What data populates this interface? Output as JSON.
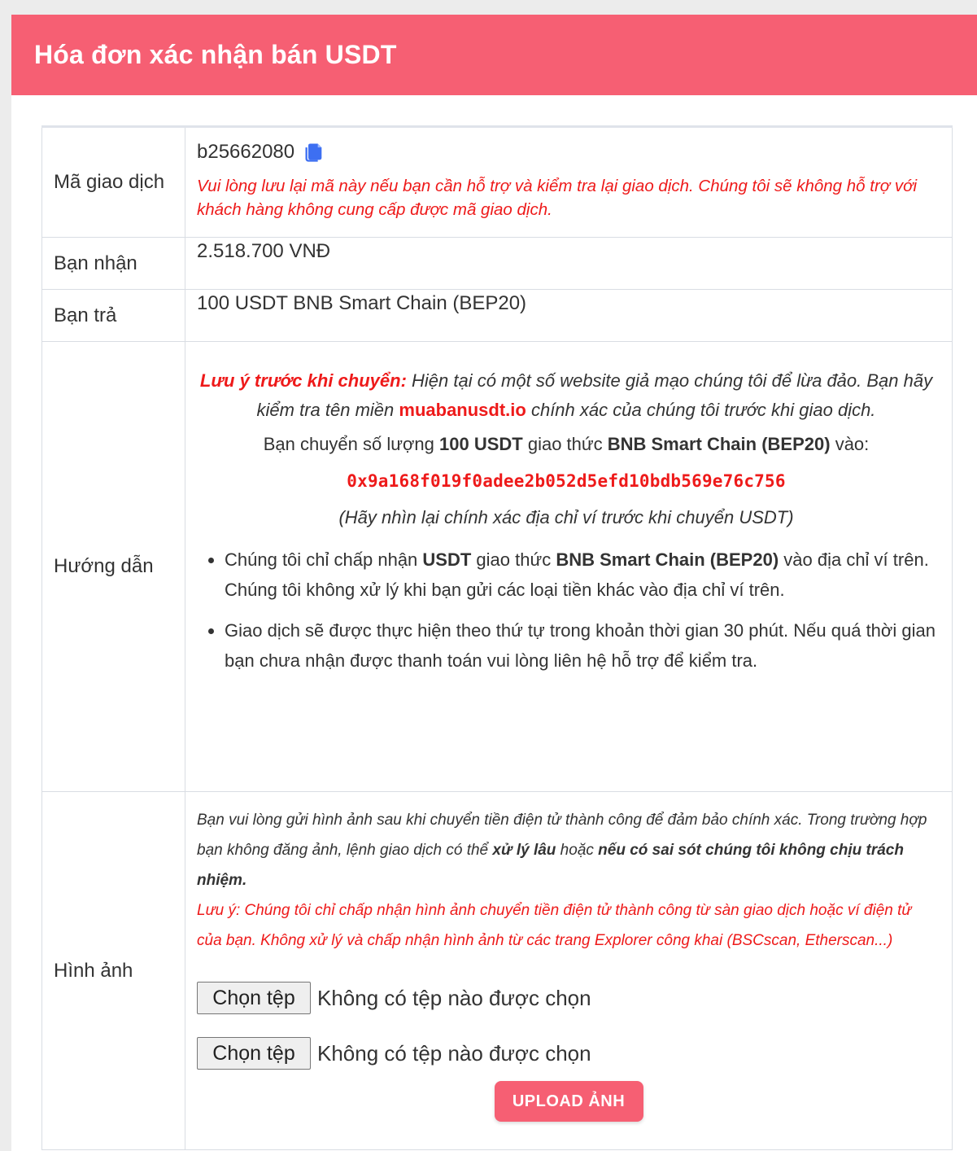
{
  "header": {
    "title": "Hóa đơn xác nhận bán USDT"
  },
  "rows": {
    "transaction": {
      "label": "Mã giao dịch",
      "code": "b25662080",
      "copy_icon": "copy-icon",
      "warning": "Vui lòng lưu lại mã này nếu bạn cần hỗ trợ và kiểm tra lại giao dịch. Chúng tôi sẽ không hỗ trợ với khách hàng không cung cấp được mã giao dịch."
    },
    "receive": {
      "label": "Bạn nhận",
      "value": "2.518.700 VNĐ"
    },
    "pay": {
      "label": "Bạn trả",
      "value": "100 USDT BNB Smart Chain (BEP20)"
    },
    "guide": {
      "label": "Hướng dẫn",
      "note_prefix": "Lưu ý trước khi chuyển:",
      "note_text1": " Hiện tại có một số website giả mạo chúng tôi để lừa đảo. Bạn hãy kiểm tra tên miền ",
      "domain": "muabanusdt.io",
      "note_text2": " chính xác của chúng tôi trước khi giao dịch.",
      "transfer_prefix": "Bạn chuyển số lượng ",
      "amount": "100 USDT",
      "protocol_word": " giao thức ",
      "protocol": "BNB Smart Chain (BEP20)",
      "transfer_suffix": " vào:",
      "address": "0x9a168f019f0adee2b052d5efd10bdb569e76c756",
      "check_note": "(Hãy nhìn lại chính xác địa chỉ ví trước khi chuyển USDT)",
      "rule1_a": "Chúng tôi chỉ chấp nhận ",
      "rule1_b": "USDT",
      "rule1_c": " giao thức ",
      "rule1_d": "BNB Smart Chain (BEP20)",
      "rule1_e": " vào địa chỉ ví trên. Chúng tôi không xử lý khi bạn gửi các loại tiền khác vào địa chỉ ví trên.",
      "rule2": "Giao dịch sẽ được thực hiện theo thứ tự trong khoản thời gian 30 phút. Nếu quá thời gian bạn chưa nhận được thanh toán vui lòng liên hệ hỗ trợ để kiểm tra."
    },
    "image": {
      "label": "Hình ảnh",
      "note_a": "Bạn vui lòng gửi hình ảnh sau khi chuyển tiền điện tử thành công để đảm bảo chính xác. Trong trường hợp bạn không đăng ảnh, lệnh giao dịch có thể ",
      "note_b": "xử lý lâu",
      "note_c": " hoặc ",
      "note_d": "nếu có sai sót chúng tôi không chịu trách nhiệm.",
      "red_note": "Lưu ý: Chúng tôi chỉ chấp nhận hình ảnh chuyển tiền điện tử thành công từ sàn giao dịch hoặc ví điện tử của bạn. Không xử lý và chấp nhận hình ảnh từ các trang Explorer công khai (BSCscan, Etherscan...)",
      "file_button": "Chọn tệp",
      "file_status": "Không có tệp nào được chọn",
      "upload_button": "UPLOAD ẢNH"
    }
  },
  "colors": {
    "accent": "#f65f73",
    "warning": "#ee1a1a",
    "copy_icon": "#3d6ff2"
  }
}
